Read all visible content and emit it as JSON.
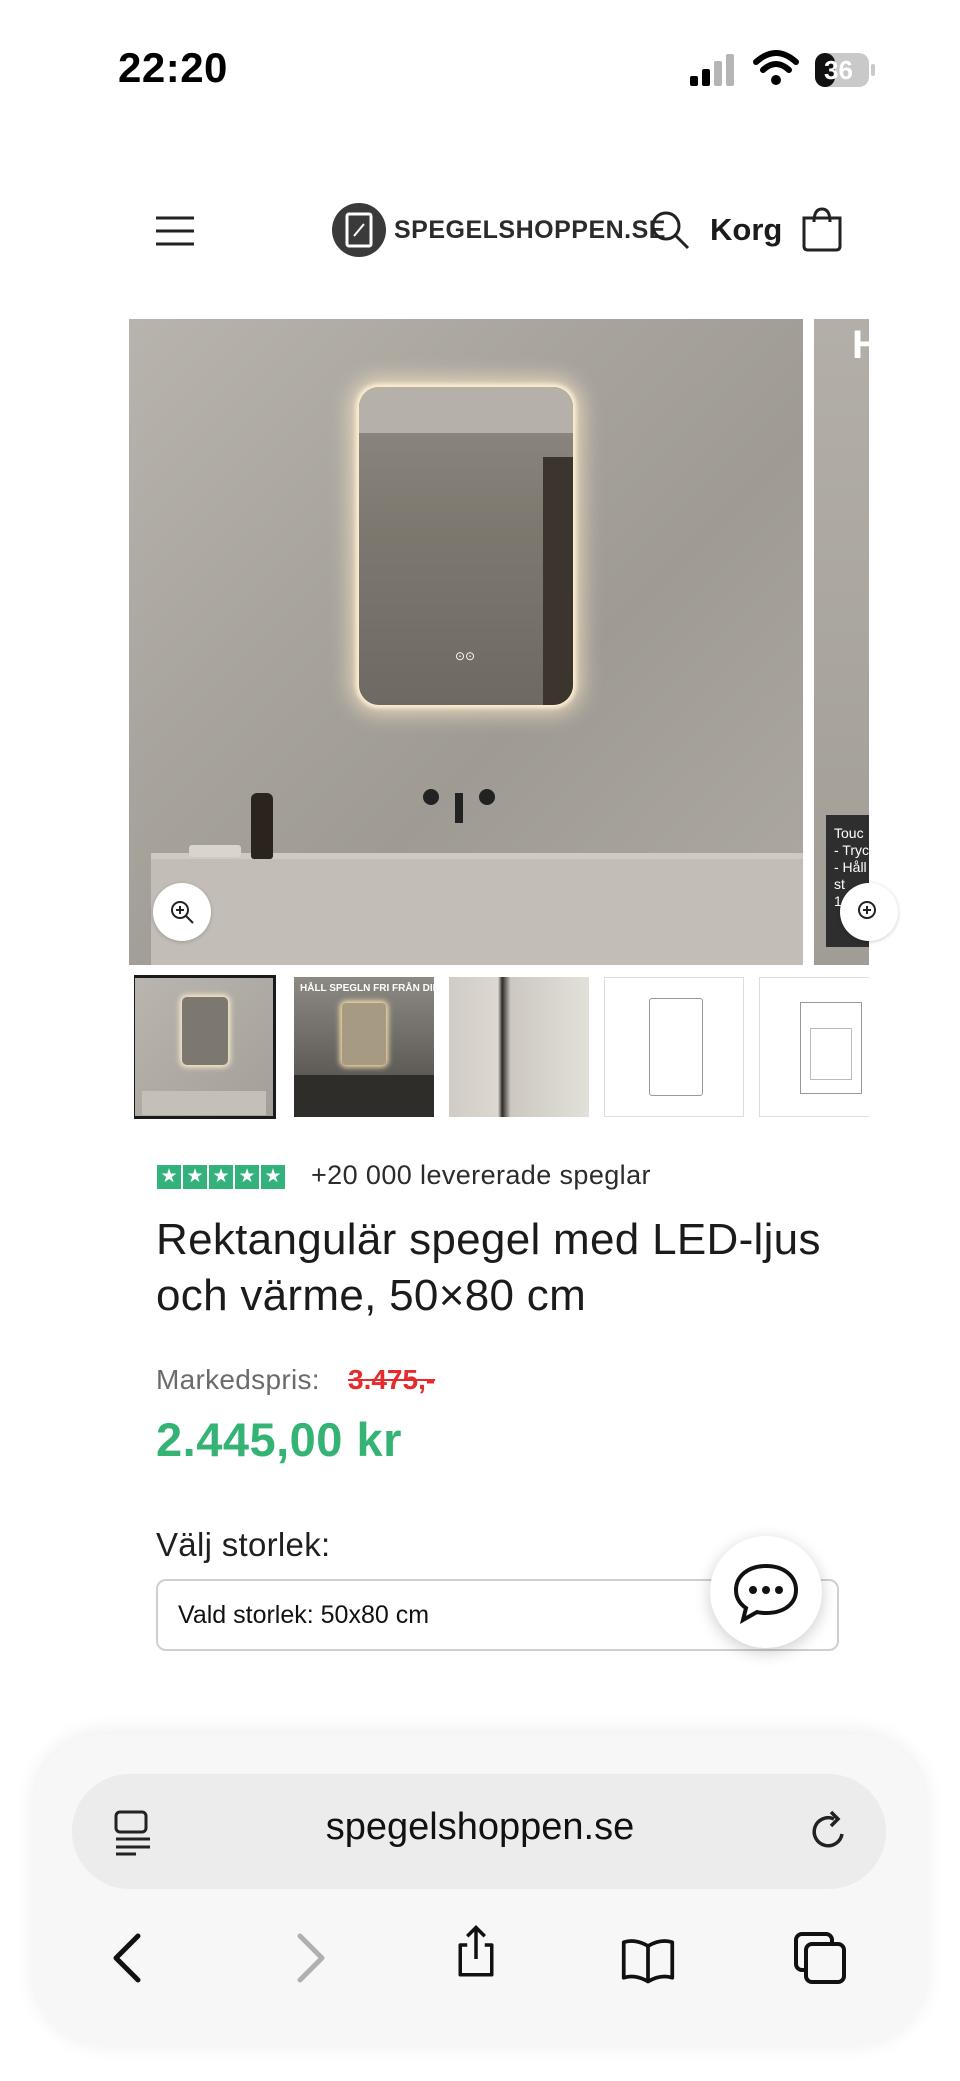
{
  "status_bar": {
    "time": "22:20",
    "battery": "36",
    "icons": [
      "signal-icon",
      "wifi-icon",
      "battery-icon"
    ]
  },
  "header": {
    "menu_icon": "hamburger-icon",
    "logo_text": "SPEGELSHOPPEN.SE",
    "search_icon": "search-icon",
    "cart_label": "Korg",
    "cart_icon": "bag-icon"
  },
  "gallery": {
    "next_slide_title_fragment": "H",
    "next_slide_text_fragment": "Touc\n- Tryc\n- Håll\nst\n1",
    "thumb_caption": "HÅLL SPEGLN FRI FRÅN DIMMA",
    "active_thumb": 1,
    "thumb_count": 5
  },
  "product": {
    "rating_stars": 5,
    "delivered_text": "+20 000 levererade speglar",
    "title": "Rektangulär spegel med LED-ljus och värme, 50×80 cm",
    "compare_label": "Markedspris:",
    "compare_price": "3.475,-",
    "price": "2.445,00 kr",
    "size_label": "Välj storlek:",
    "size_selected": "Vald storlek: 50x80 cm"
  },
  "browser": {
    "url": "spegelshoppen.se",
    "icons": [
      "reader-icon",
      "reload-icon",
      "back-icon",
      "forward-icon",
      "share-icon",
      "bookmarks-icon",
      "tabs-icon"
    ]
  },
  "colors": {
    "price_green": "#34b374",
    "strike_red": "#e52b2b",
    "star_green": "#33b27c"
  }
}
